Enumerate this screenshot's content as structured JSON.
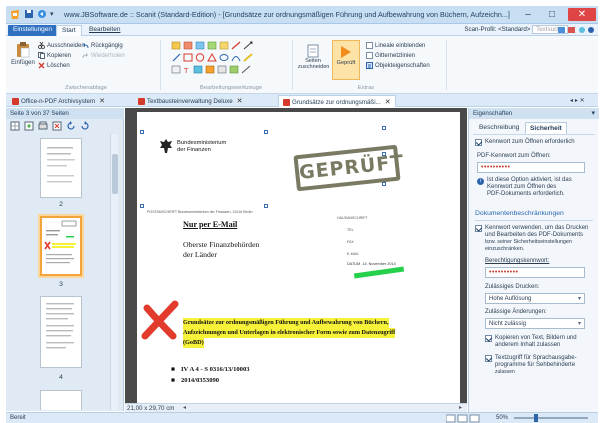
{
  "window": {
    "title": "www.JBSoftware.de :: Scanit (Standard-Edition) - [Grundsätze zur ordnungsmäßigen Führung und Aufbewahrung von Büchern, Aufzeichn...]",
    "minimize": "–",
    "maximize": "□",
    "close": "✕"
  },
  "ribbon": {
    "tabs": [
      "Einstellungen",
      "Start",
      "Bearbeiten"
    ],
    "scan_profile_label": "Scan-Profil:",
    "scan_profile_value": "<Standard>",
    "scan_search_placeholder": "Textsuche",
    "clipboard": {
      "paste": "Einfügen",
      "cut": "Ausschneiden",
      "copy": "Kopieren",
      "delete": "Löschen",
      "undo": "Rückgängig",
      "redo": "Wiederholen",
      "group_label": "Zwischenablage"
    },
    "tools_group_label": "Bearbeitungswerkzeuge",
    "extras": {
      "fit_pages": "Seiten zuschneiden",
      "checked": "Geprüft",
      "show_ruler": "Lineale einblenden",
      "grid_lines": "Gitternetzlinien",
      "object_props": "Objekteigenschaften",
      "group_label": "Extras"
    }
  },
  "doc_tabs": [
    "Office-n-PDF Archivsystem",
    "Textbausteinverwaltung Deluxe",
    "Grundsätze zur ordnungsmäßi..."
  ],
  "doc_tabs_nav": "◂ ▸ ✕",
  "left_panel": {
    "header": "Seite 3 von 37 Seiten",
    "page_numbers": [
      "2",
      "3",
      "4"
    ]
  },
  "document": {
    "ministry": [
      "Bundesministerium",
      "der Finanzen"
    ],
    "stamp": "GEPRÜFT",
    "address_line": "POSTANSCHRIFT Bundesministerium der Finanzen, 11016 Berlin",
    "mail_type": "Nur per E-Mail",
    "recipient": [
      "Oberste Finanzbehörden",
      "der Länder"
    ],
    "right_labels": [
      "HAUSANSCHRIFT",
      "TEL",
      "FAX",
      "E-MAIL",
      "DATUM"
    ],
    "date_value": "14. November 2014",
    "subject": [
      "Grundsätze zur ordnungsmäßigen Führung und Aufbewahrung von Büchern,",
      "Aufzeichnungen und Unterlagen in elektronischer Form sowie zum Datenzugriff",
      "(GoBD)"
    ],
    "ref1": "IV A 4 - S 0316/13/10003",
    "ref2": "2014/0353090",
    "page_size": "21,00 x 29,70 cm"
  },
  "properties": {
    "header": "Eigenschaften",
    "tabs": [
      "Beschreibung",
      "Sicherheit"
    ],
    "open_pw_required": "Kennwort zum Öffnen erforderlich",
    "open_pw_label": "PDF-Kennwort zum Öffnen:",
    "open_pw_value": "••••••••••",
    "info_text": [
      "Ist diese Option aktiviert, ist das",
      "Kennwort zum Öffnen des",
      "PDF-Dokuments erforderlich."
    ],
    "section_title": "Dokumentenbeschränkungen",
    "restrict_text": [
      "Kennwort verwenden, um das Drucken",
      "und Bearbeiten des PDF-Dokuments",
      "bzw. seiner Sicherheitseinstellungen",
      "einzuschränken."
    ],
    "perm_pw_label": "Berechtigungskennwort:",
    "perm_pw_value": "••••••••••",
    "print_label": "Zulässiges Drucken:",
    "print_value": "Hohe Auflösung",
    "change_label": "Zulässige Änderungen:",
    "change_value": "Nicht zulässig",
    "copy_text": [
      "Kopieren von Text, Bildern und",
      "anderem Inhalt zulassen"
    ],
    "screenreader_text": [
      "Textzugriff für Sprachausgabe-",
      "programme für Sehbehinderte",
      "zulassen"
    ]
  },
  "status": {
    "left": "Bereit",
    "zoom": "50%"
  },
  "colors": {
    "accent": "#2f70c0",
    "stamp": "#7a7a62",
    "highlight": "#f6f23a",
    "green_marker": "#25d04a",
    "red_mark": "#e23b2b"
  }
}
